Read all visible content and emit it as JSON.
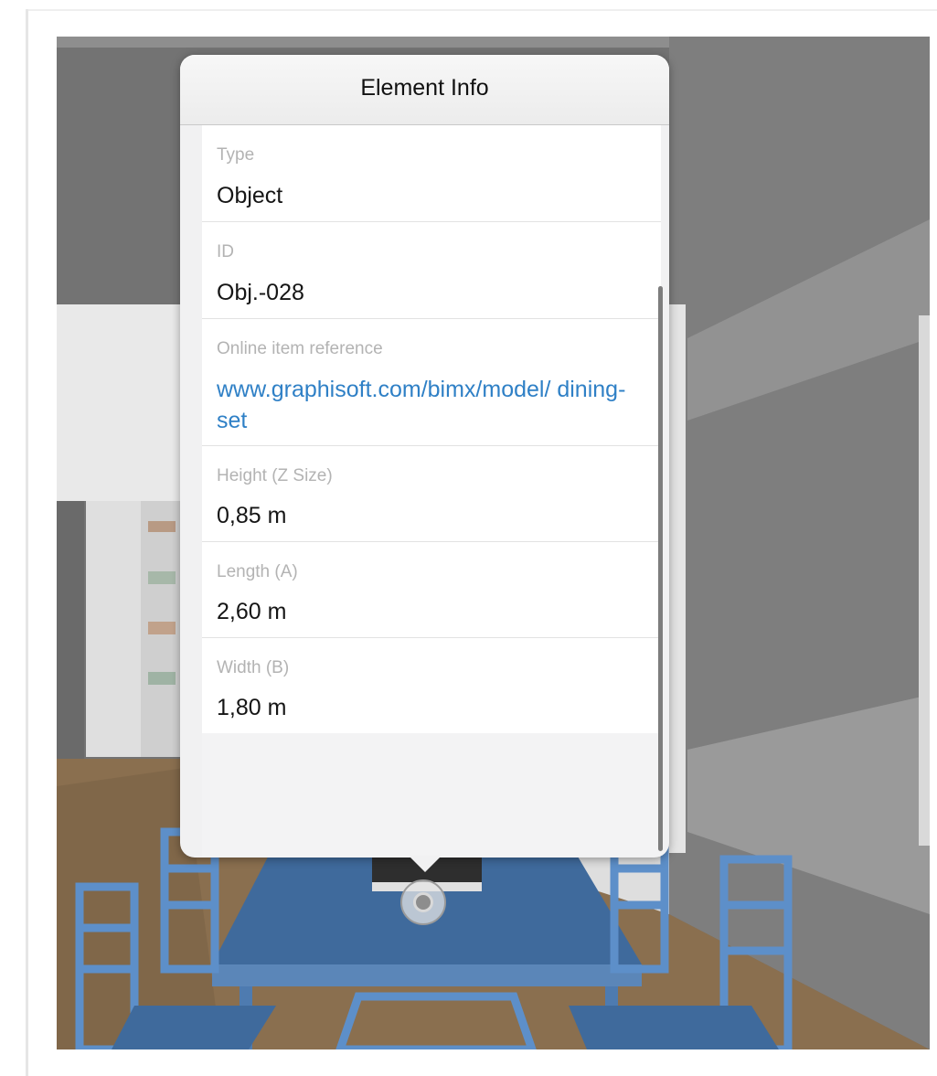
{
  "popover": {
    "title": "Element Info",
    "fields": [
      {
        "label": "Type",
        "value": "Object"
      },
      {
        "label": "ID",
        "value": "Obj.-028"
      },
      {
        "label": "Online item reference",
        "link": "www.graphisoft.com/bimx/model/ dining-set"
      },
      {
        "label": "Height (Z Size)",
        "value": "0,85 m"
      },
      {
        "label": "Length (A)",
        "value": "2,60 m"
      },
      {
        "label": "Width (B)",
        "value": "1,80 m"
      }
    ]
  },
  "scene": {
    "wall_color": "#6f6f6f",
    "floor_color": "#8a6f4f",
    "furniture_color": "#4a74a6",
    "link_color": "#2f80c6"
  }
}
